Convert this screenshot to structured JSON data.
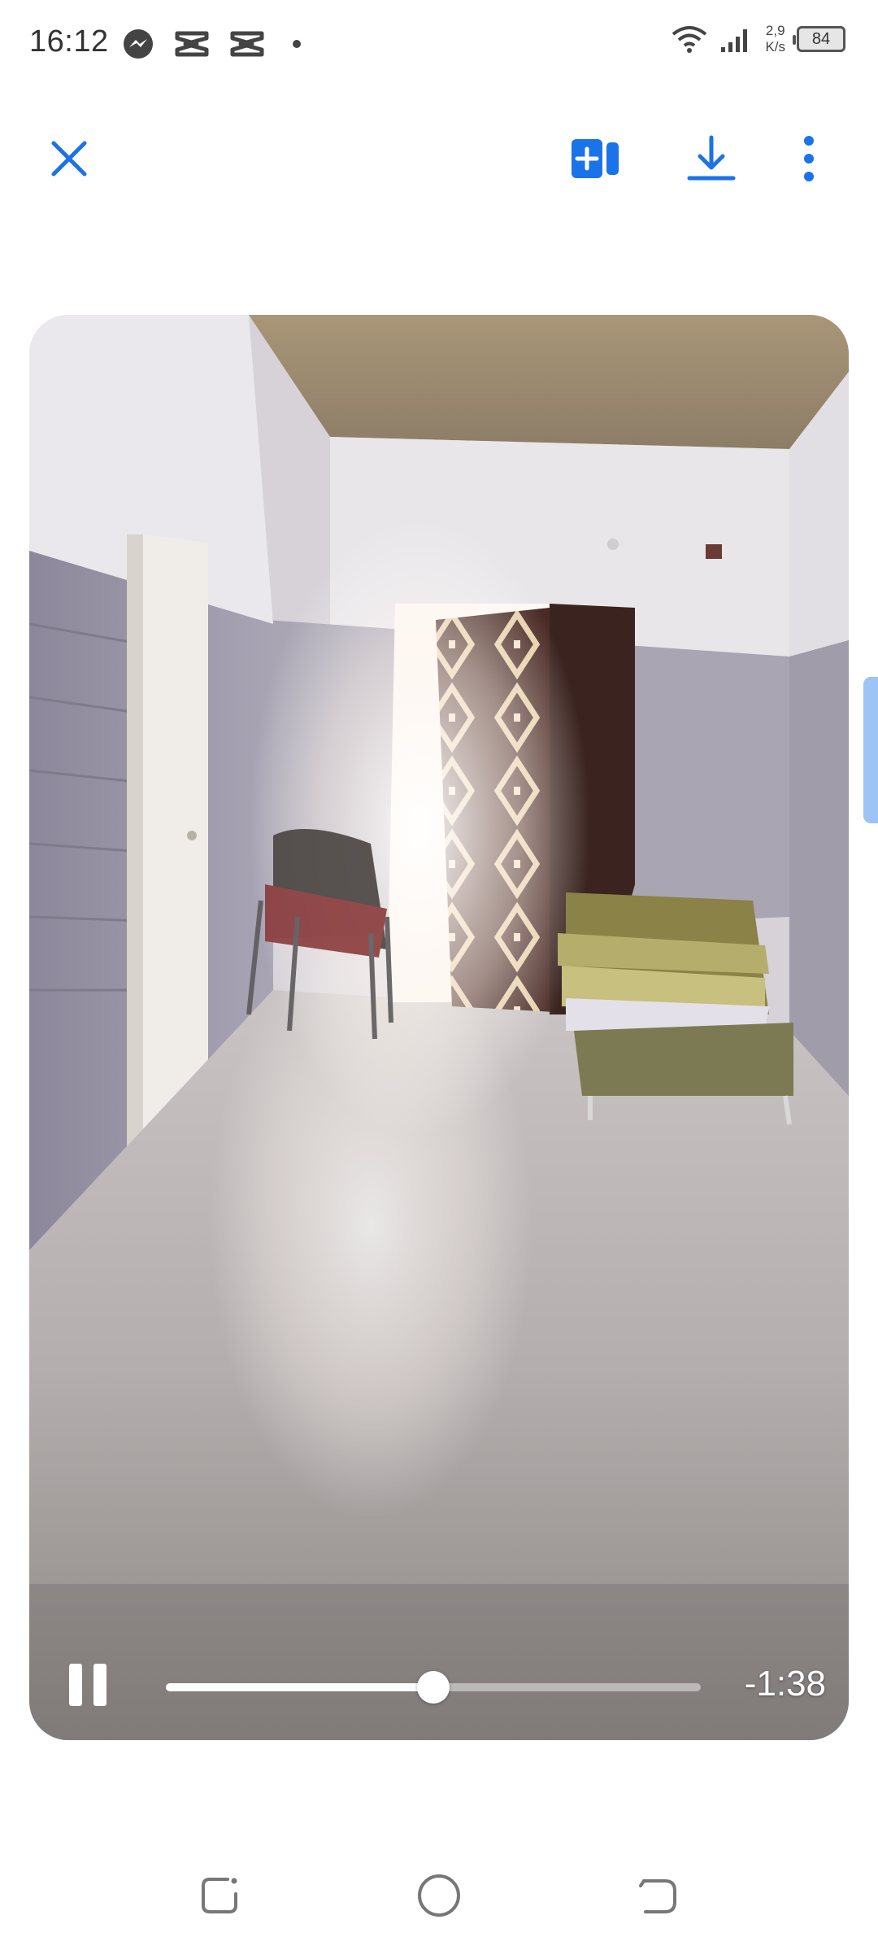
{
  "status_bar": {
    "time": "16:12",
    "net_speed_value": "2,9",
    "net_speed_unit": "K/s",
    "battery": "84",
    "icons": [
      "messenger-icon",
      "capcut-icon",
      "capcut-icon",
      "dot-icon",
      "wifi-icon",
      "signal-icon",
      "battery-icon"
    ]
  },
  "toolbar": {
    "icons": [
      "close-icon",
      "add-to-collection-icon",
      "download-icon",
      "more-vertical-icon"
    ],
    "accent_color": "#1a73e8"
  },
  "video": {
    "time_remaining": "-1:38",
    "progress": 0.5,
    "playing": true,
    "icons": [
      "pause-icon"
    ]
  },
  "nav_bar": {
    "icons": [
      "recent-apps-icon",
      "home-icon",
      "back-icon"
    ]
  }
}
